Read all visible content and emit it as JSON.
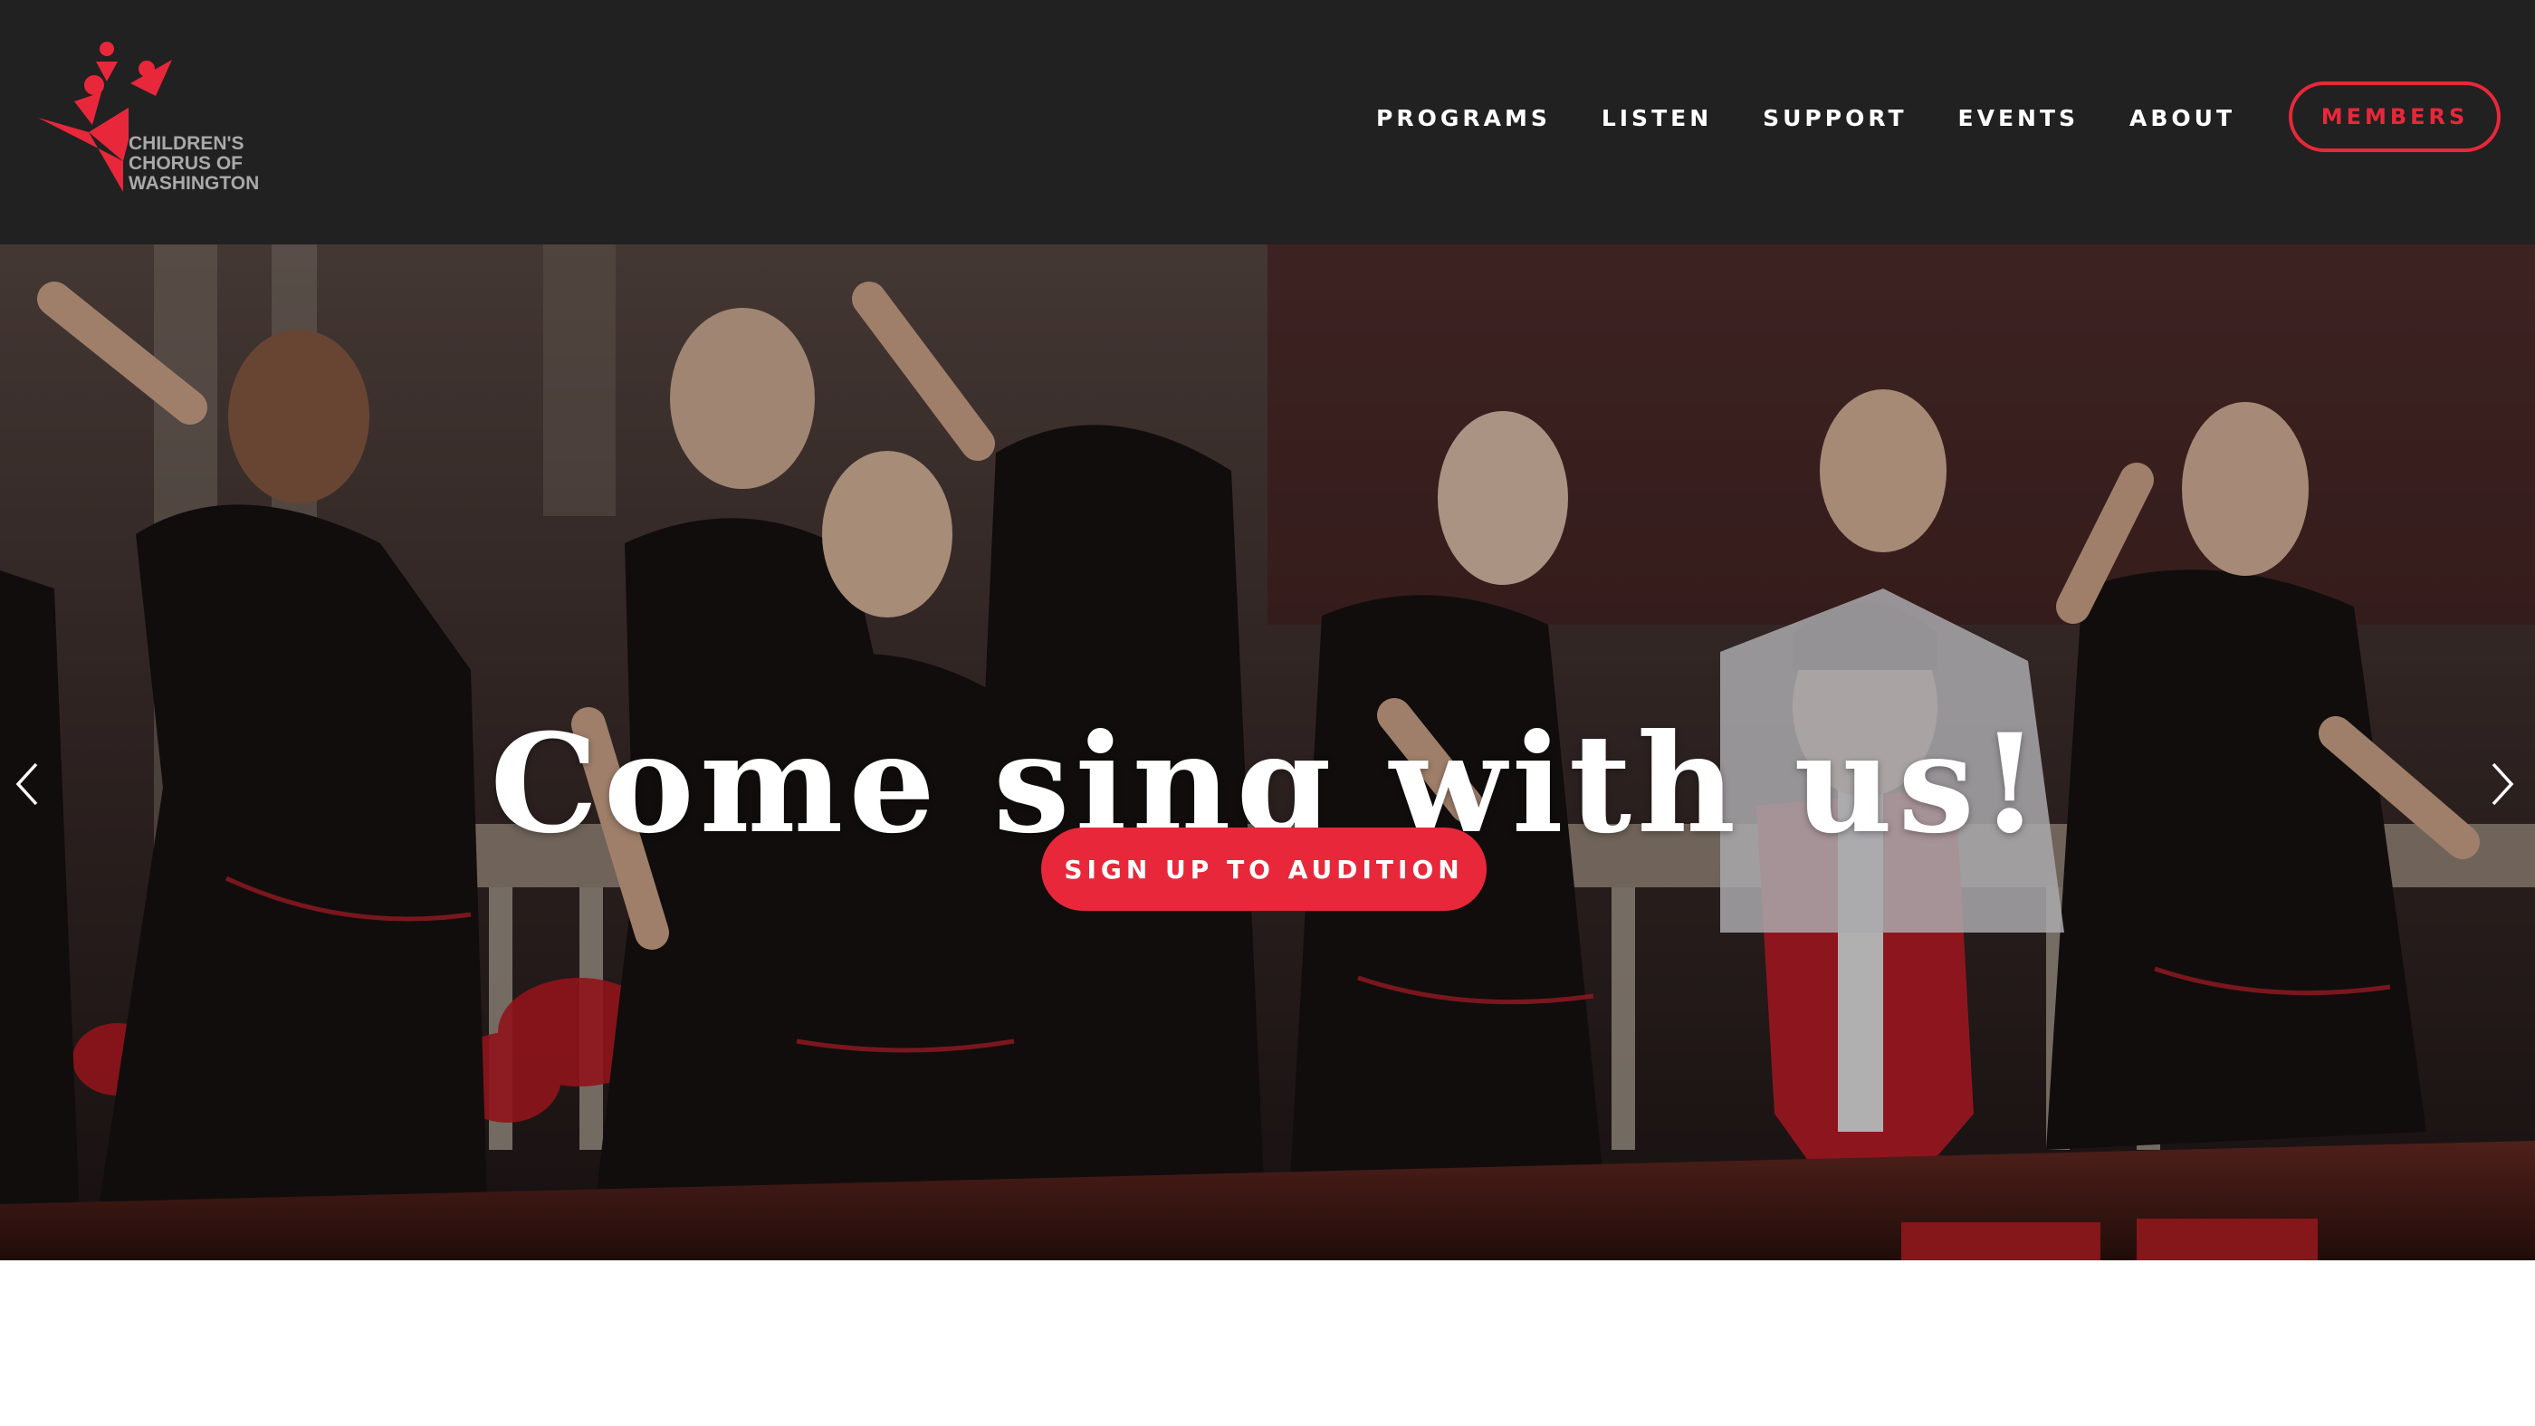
{
  "header": {
    "logo": {
      "lines": [
        "CHILDREN'S",
        "CHORUS OF",
        "WASHINGTON"
      ],
      "icon": "choir-figures-logo-icon",
      "color": "#e8283a"
    },
    "nav": {
      "items": [
        {
          "label": "PROGRAMS"
        },
        {
          "label": "LISTEN"
        },
        {
          "label": "SUPPORT"
        },
        {
          "label": "EVENTS"
        },
        {
          "label": "ABOUT"
        }
      ],
      "members_label": "MEMBERS"
    }
  },
  "hero": {
    "title": "Come sing with us!",
    "cta_label": "SIGN UP TO AUDITION",
    "prev_icon": "chevron-left-icon",
    "next_icon": "chevron-right-icon"
  },
  "colors": {
    "header_bg": "#212121",
    "accent": "#e8283a",
    "nav_text": "#ffffff"
  }
}
